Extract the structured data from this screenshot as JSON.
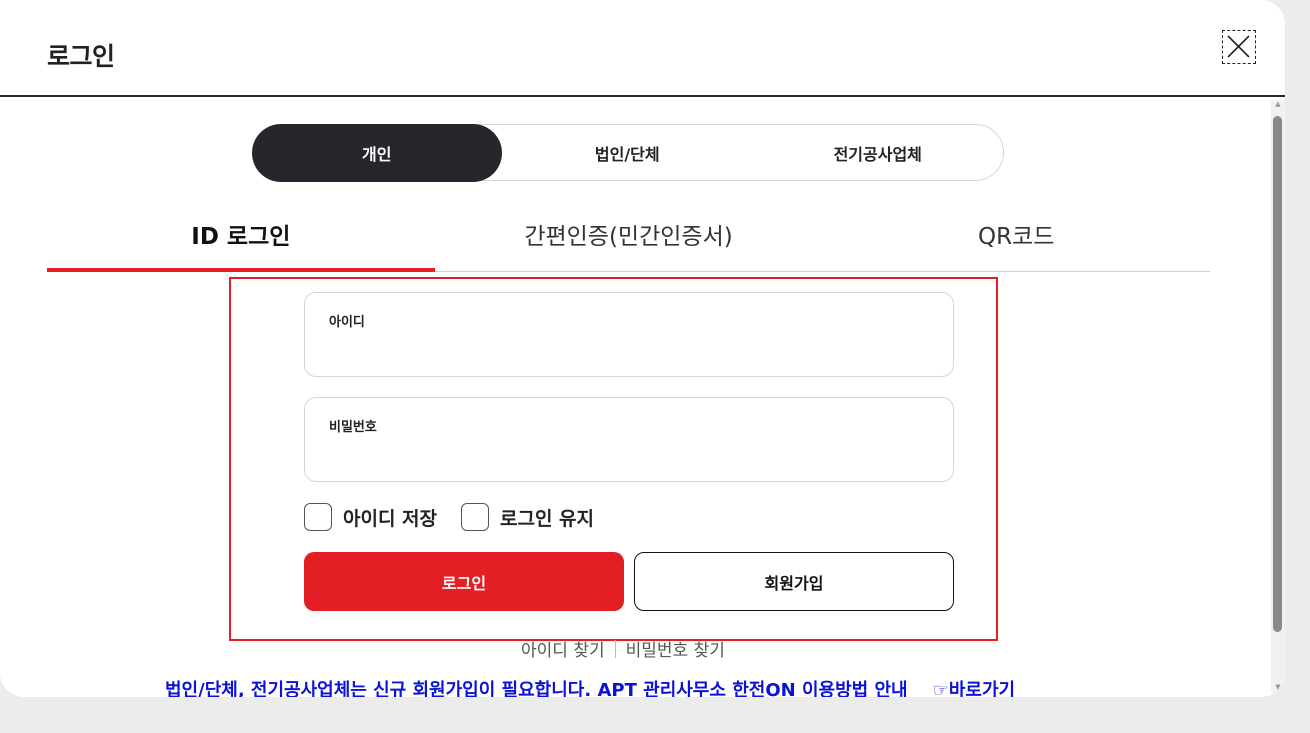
{
  "header": {
    "title": "로그인",
    "close_icon": "close-icon"
  },
  "member_type": {
    "items": [
      "개인",
      "법인/단체",
      "전기공사업체"
    ],
    "selected": "개인"
  },
  "login_tabs": {
    "items": [
      "ID 로그인",
      "간편인증(민간인증서)",
      "QR코드"
    ],
    "selected": "ID 로그인"
  },
  "form": {
    "id_label": "아이디",
    "id_value": "",
    "password_label": "비밀번호",
    "password_value": "",
    "save_id_label": "아이디 저장",
    "save_id_checked": false,
    "keep_login_label": "로그인 유지",
    "keep_login_checked": false,
    "login_button": "로그인",
    "join_button": "회원가입"
  },
  "links": {
    "find_id": "아이디 찾기",
    "find_password": "비밀번호 찾기"
  },
  "notice": {
    "text": "법인/단체, 전기공사업체는 신규 회원가입이 필요합니다. APT 관리사무소 한전ON 이용방법 안내",
    "shortcut_icon": "☞",
    "shortcut_label": "바로가기"
  },
  "colors": {
    "accent": "#e31e24",
    "dark_segment": "#26272c",
    "notice_blue": "#0b12d6"
  }
}
